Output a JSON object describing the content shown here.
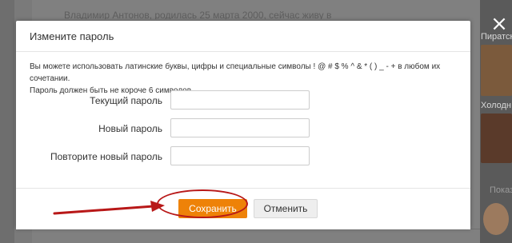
{
  "background": {
    "top_text": "Владимир Антонов, родилась 25 марта 2000, сейчас живу в",
    "right_labels": [
      "Пиратск",
      "Холодн",
      "Показ"
    ]
  },
  "dialog": {
    "title": "Измените пароль",
    "hint_line1": "Вы можете использовать латинские буквы, цифры и специальные символы ! @ # $ % ^ & * ( ) _ - + в любом их сочетании.",
    "hint_line2": "Пароль должен быть не короче 6 символов.",
    "fields": [
      {
        "label": "Текущий пароль",
        "value": "",
        "placeholder": ""
      },
      {
        "label": "Новый пароль",
        "value": "",
        "placeholder": ""
      },
      {
        "label": "Повторите новый пароль",
        "value": "",
        "placeholder": ""
      }
    ],
    "save_label": "Сохранить",
    "cancel_label": "Отменить",
    "close_icon": "close-icon"
  },
  "colors": {
    "accent": "#ee8208",
    "annotation": "#b81818"
  }
}
